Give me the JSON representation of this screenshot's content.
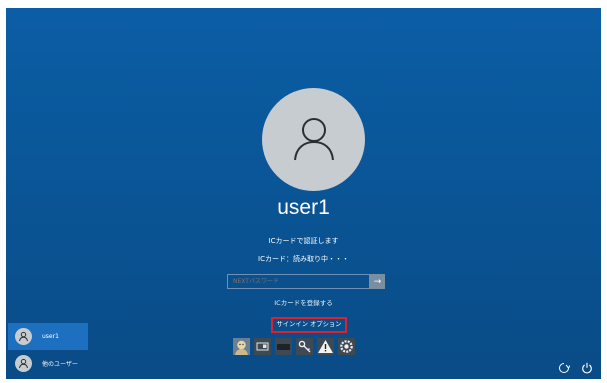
{
  "login": {
    "username": "user1",
    "message_primary": "ICカードで認証します",
    "message_status": "ICカード：読み取り中・・・",
    "password_placeholder": "NEXTパスワード",
    "register_card_link": "ICカードを登録する",
    "signin_options_label": "サインイン オプション"
  },
  "credential_icons": [
    "face-icon",
    "id-card-icon",
    "card-icon",
    "key-icon",
    "warning-icon",
    "gear-icon"
  ],
  "user_switcher": [
    {
      "name": "user1",
      "active": true
    },
    {
      "name": "他のユーザー",
      "active": false
    }
  ],
  "colors": {
    "background": "#0a5391",
    "highlight_border": "#e0202a",
    "active_user": "#1d6fbf"
  }
}
